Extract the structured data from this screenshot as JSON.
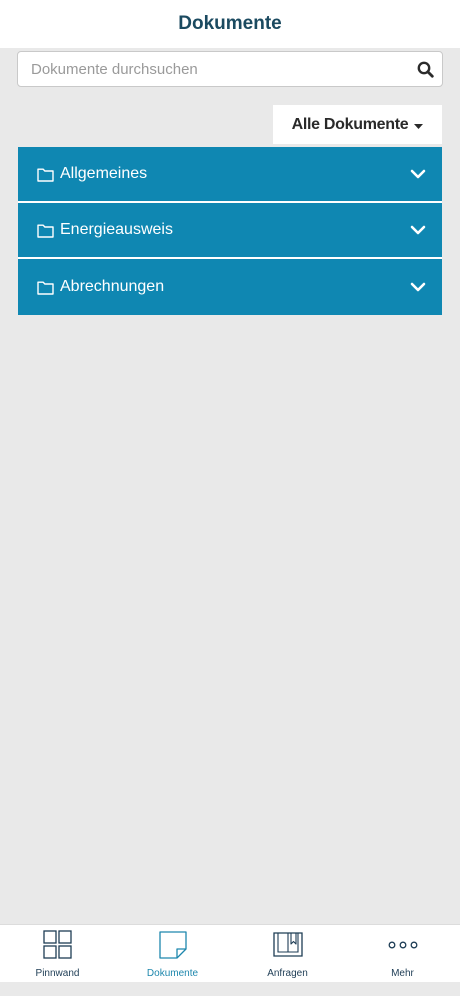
{
  "header": {
    "title": "Dokumente"
  },
  "search": {
    "placeholder": "Dokumente durchsuchen",
    "value": "",
    "icon": "search-icon"
  },
  "filter": {
    "label": "Alle Dokumente",
    "icon": "caret-down-icon"
  },
  "folders": [
    {
      "label": "Allgemeines",
      "icon": "folder-icon"
    },
    {
      "label": "Energieausweis",
      "icon": "folder-icon"
    },
    {
      "label": "Abrechnungen",
      "icon": "folder-icon"
    }
  ],
  "bottom_nav": {
    "items": [
      {
        "label": "Pinnwand",
        "icon": "grid-icon",
        "active": false
      },
      {
        "label": "Dokumente",
        "icon": "document-icon",
        "active": true
      },
      {
        "label": "Anfragen",
        "icon": "book-icon",
        "active": false
      },
      {
        "label": "Mehr",
        "icon": "more-icon",
        "active": false
      }
    ]
  },
  "colors": {
    "accent": "#0f87b2",
    "header_text": "#1b4a60",
    "nav_active": "#1d87ad",
    "background": "#e9e9e9"
  }
}
